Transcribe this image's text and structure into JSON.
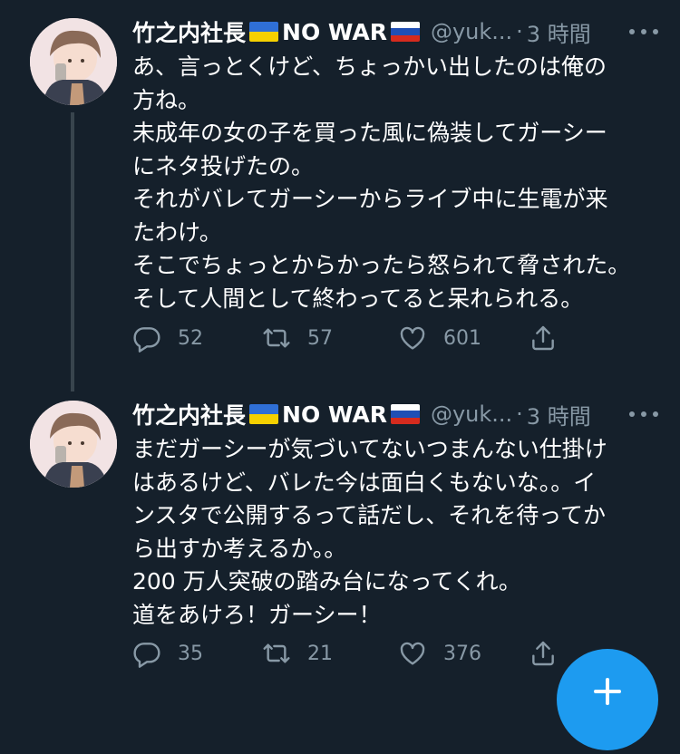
{
  "tweets": [
    {
      "user_name": "竹之内社長",
      "flag_after_name": "ukraine-flag",
      "name_suffix": "NO WAR",
      "flag_end": "russia-flag",
      "handle": "@yuk...",
      "separator": "·",
      "time": "3 時間",
      "lines": [
        "あ、言っとくけど、ちょっかい出したのは俺の",
        "方ね。",
        "未成年の女の子を買った風に偽装してガーシー",
        "にネタ投げたの。",
        "それがバレてガーシーからライブ中に生電が来",
        "たわけ。",
        "そこでちょっとからかったら怒られて脅された。",
        "そして人間として終わってると呆れられる。"
      ],
      "replies": "52",
      "retweets": "57",
      "likes": "601"
    },
    {
      "user_name": "竹之内社長",
      "flag_after_name": "ukraine-flag",
      "name_suffix": "NO WAR",
      "flag_end": "russia-flag",
      "handle": "@yuk...",
      "separator": "·",
      "time": "3 時間",
      "lines": [
        "まだガーシーが気づいてないつまんない仕掛け",
        "はあるけど、バレた今は面白くもないな。。イ",
        "ンスタで公開するって話だし、それを待ってか",
        "ら出すか考えるか。。",
        "200 万人突破の踏み台になってくれ。",
        "道をあけろ！ガーシー！"
      ],
      "replies": "35",
      "retweets": "21",
      "likes": "376"
    }
  ],
  "colors": {
    "background": "#15202b",
    "text": "#ffffff",
    "secondary": "#8899a6",
    "accent": "#1d9bf0",
    "thread_line": "#38444d"
  },
  "icons": {
    "reply": "reply-icon",
    "retweet": "retweet-icon",
    "like": "heart-icon",
    "share": "share-icon",
    "more": "more-icon",
    "compose": "compose-icon"
  }
}
